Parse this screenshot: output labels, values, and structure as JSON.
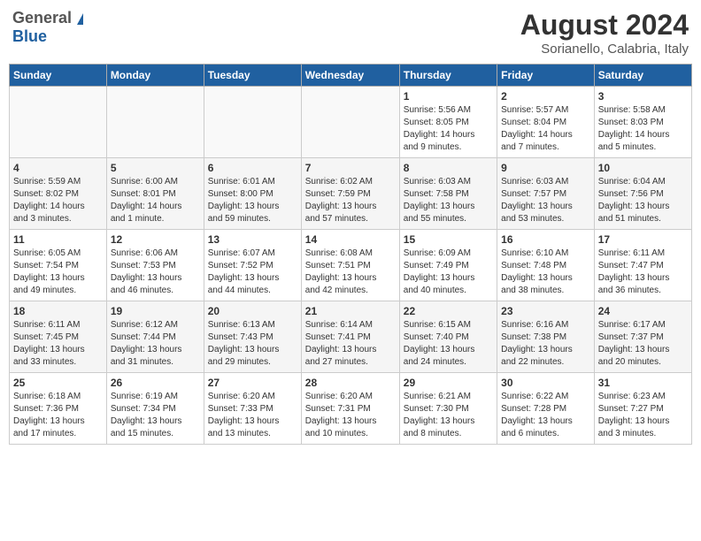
{
  "header": {
    "logo_general": "General",
    "logo_blue": "Blue",
    "title": "August 2024",
    "subtitle": "Sorianello, Calabria, Italy"
  },
  "calendar": {
    "days_of_week": [
      "Sunday",
      "Monday",
      "Tuesday",
      "Wednesday",
      "Thursday",
      "Friday",
      "Saturday"
    ],
    "weeks": [
      [
        {
          "day": "",
          "info": ""
        },
        {
          "day": "",
          "info": ""
        },
        {
          "day": "",
          "info": ""
        },
        {
          "day": "",
          "info": ""
        },
        {
          "day": "1",
          "info": "Sunrise: 5:56 AM\nSunset: 8:05 PM\nDaylight: 14 hours\nand 9 minutes."
        },
        {
          "day": "2",
          "info": "Sunrise: 5:57 AM\nSunset: 8:04 PM\nDaylight: 14 hours\nand 7 minutes."
        },
        {
          "day": "3",
          "info": "Sunrise: 5:58 AM\nSunset: 8:03 PM\nDaylight: 14 hours\nand 5 minutes."
        }
      ],
      [
        {
          "day": "4",
          "info": "Sunrise: 5:59 AM\nSunset: 8:02 PM\nDaylight: 14 hours\nand 3 minutes."
        },
        {
          "day": "5",
          "info": "Sunrise: 6:00 AM\nSunset: 8:01 PM\nDaylight: 14 hours\nand 1 minute."
        },
        {
          "day": "6",
          "info": "Sunrise: 6:01 AM\nSunset: 8:00 PM\nDaylight: 13 hours\nand 59 minutes."
        },
        {
          "day": "7",
          "info": "Sunrise: 6:02 AM\nSunset: 7:59 PM\nDaylight: 13 hours\nand 57 minutes."
        },
        {
          "day": "8",
          "info": "Sunrise: 6:03 AM\nSunset: 7:58 PM\nDaylight: 13 hours\nand 55 minutes."
        },
        {
          "day": "9",
          "info": "Sunrise: 6:03 AM\nSunset: 7:57 PM\nDaylight: 13 hours\nand 53 minutes."
        },
        {
          "day": "10",
          "info": "Sunrise: 6:04 AM\nSunset: 7:56 PM\nDaylight: 13 hours\nand 51 minutes."
        }
      ],
      [
        {
          "day": "11",
          "info": "Sunrise: 6:05 AM\nSunset: 7:54 PM\nDaylight: 13 hours\nand 49 minutes."
        },
        {
          "day": "12",
          "info": "Sunrise: 6:06 AM\nSunset: 7:53 PM\nDaylight: 13 hours\nand 46 minutes."
        },
        {
          "day": "13",
          "info": "Sunrise: 6:07 AM\nSunset: 7:52 PM\nDaylight: 13 hours\nand 44 minutes."
        },
        {
          "day": "14",
          "info": "Sunrise: 6:08 AM\nSunset: 7:51 PM\nDaylight: 13 hours\nand 42 minutes."
        },
        {
          "day": "15",
          "info": "Sunrise: 6:09 AM\nSunset: 7:49 PM\nDaylight: 13 hours\nand 40 minutes."
        },
        {
          "day": "16",
          "info": "Sunrise: 6:10 AM\nSunset: 7:48 PM\nDaylight: 13 hours\nand 38 minutes."
        },
        {
          "day": "17",
          "info": "Sunrise: 6:11 AM\nSunset: 7:47 PM\nDaylight: 13 hours\nand 36 minutes."
        }
      ],
      [
        {
          "day": "18",
          "info": "Sunrise: 6:11 AM\nSunset: 7:45 PM\nDaylight: 13 hours\nand 33 minutes."
        },
        {
          "day": "19",
          "info": "Sunrise: 6:12 AM\nSunset: 7:44 PM\nDaylight: 13 hours\nand 31 minutes."
        },
        {
          "day": "20",
          "info": "Sunrise: 6:13 AM\nSunset: 7:43 PM\nDaylight: 13 hours\nand 29 minutes."
        },
        {
          "day": "21",
          "info": "Sunrise: 6:14 AM\nSunset: 7:41 PM\nDaylight: 13 hours\nand 27 minutes."
        },
        {
          "day": "22",
          "info": "Sunrise: 6:15 AM\nSunset: 7:40 PM\nDaylight: 13 hours\nand 24 minutes."
        },
        {
          "day": "23",
          "info": "Sunrise: 6:16 AM\nSunset: 7:38 PM\nDaylight: 13 hours\nand 22 minutes."
        },
        {
          "day": "24",
          "info": "Sunrise: 6:17 AM\nSunset: 7:37 PM\nDaylight: 13 hours\nand 20 minutes."
        }
      ],
      [
        {
          "day": "25",
          "info": "Sunrise: 6:18 AM\nSunset: 7:36 PM\nDaylight: 13 hours\nand 17 minutes."
        },
        {
          "day": "26",
          "info": "Sunrise: 6:19 AM\nSunset: 7:34 PM\nDaylight: 13 hours\nand 15 minutes."
        },
        {
          "day": "27",
          "info": "Sunrise: 6:20 AM\nSunset: 7:33 PM\nDaylight: 13 hours\nand 13 minutes."
        },
        {
          "day": "28",
          "info": "Sunrise: 6:20 AM\nSunset: 7:31 PM\nDaylight: 13 hours\nand 10 minutes."
        },
        {
          "day": "29",
          "info": "Sunrise: 6:21 AM\nSunset: 7:30 PM\nDaylight: 13 hours\nand 8 minutes."
        },
        {
          "day": "30",
          "info": "Sunrise: 6:22 AM\nSunset: 7:28 PM\nDaylight: 13 hours\nand 6 minutes."
        },
        {
          "day": "31",
          "info": "Sunrise: 6:23 AM\nSunset: 7:27 PM\nDaylight: 13 hours\nand 3 minutes."
        }
      ]
    ]
  }
}
